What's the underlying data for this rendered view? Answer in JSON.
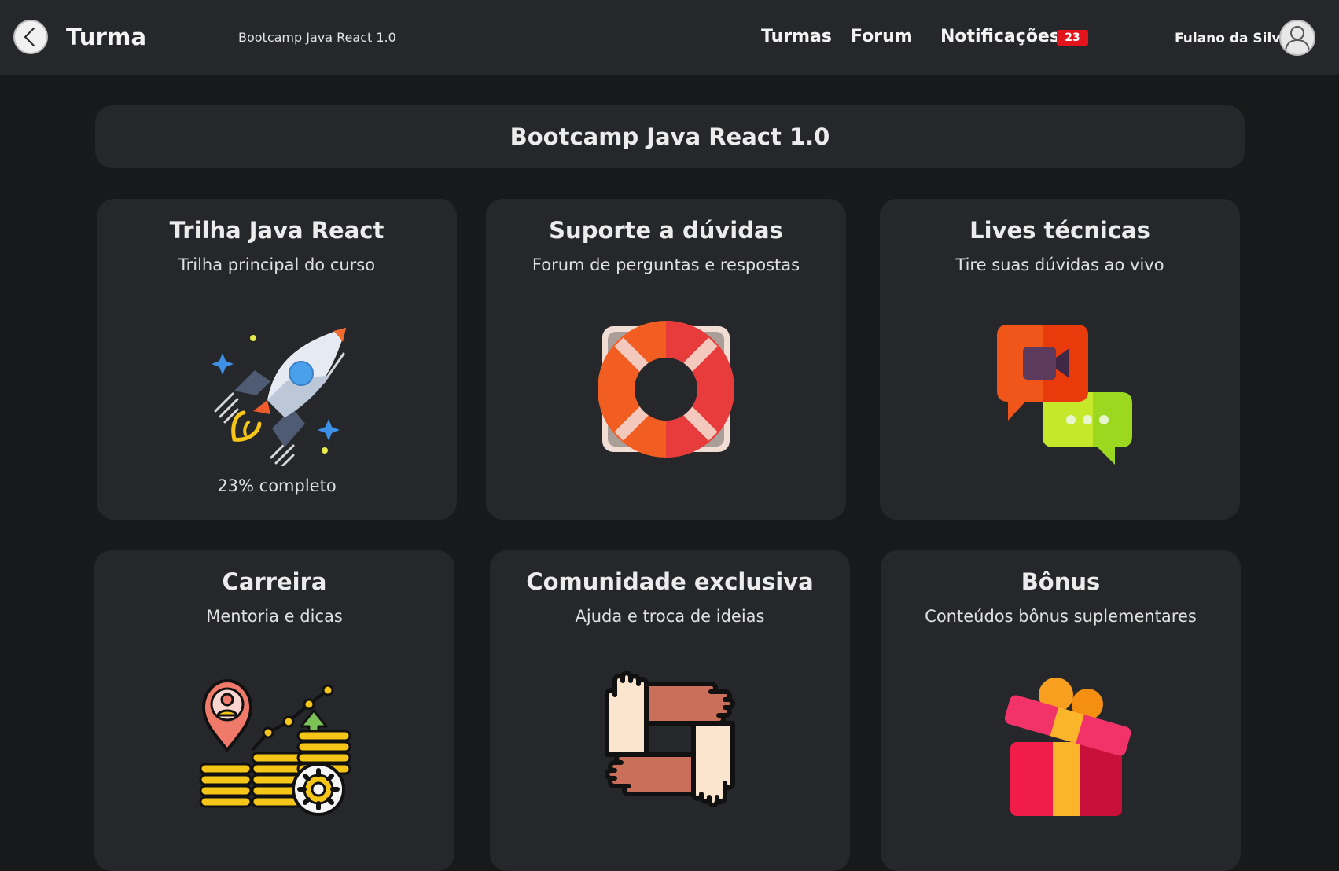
{
  "header": {
    "app_title": "Turma",
    "subtitle": "Bootcamp Java React 1.0",
    "nav": {
      "turmas": "Turmas",
      "forum": "Forum",
      "notificacoes": "Notificações"
    },
    "notification_count": "23",
    "user_name": "Fulano da Silva"
  },
  "page": {
    "title": "Bootcamp Java React 1.0"
  },
  "cards": [
    {
      "title": "Trilha Java React",
      "subtitle": "Trilha principal do curso",
      "progress": "23% completo",
      "icon": "rocket-icon"
    },
    {
      "title": "Suporte a dúvidas",
      "subtitle": "Forum de perguntas e respostas",
      "icon": "lifebuoy-icon"
    },
    {
      "title": "Lives técnicas",
      "subtitle": "Tire suas dúvidas ao vivo",
      "icon": "video-chat-icon"
    },
    {
      "title": "Carreira",
      "subtitle": "Mentoria e dicas",
      "icon": "career-growth-icon"
    },
    {
      "title": "Comunidade exclusiva",
      "subtitle": "Ajuda e troca de ideias",
      "icon": "community-hands-icon"
    },
    {
      "title": "Bônus",
      "subtitle": "Conteúdos bônus suplementares",
      "icon": "gift-icon"
    }
  ],
  "colors": {
    "background": "#18191b",
    "surface": "#26272a",
    "badge": "#e3141b",
    "text": "#ececec"
  }
}
